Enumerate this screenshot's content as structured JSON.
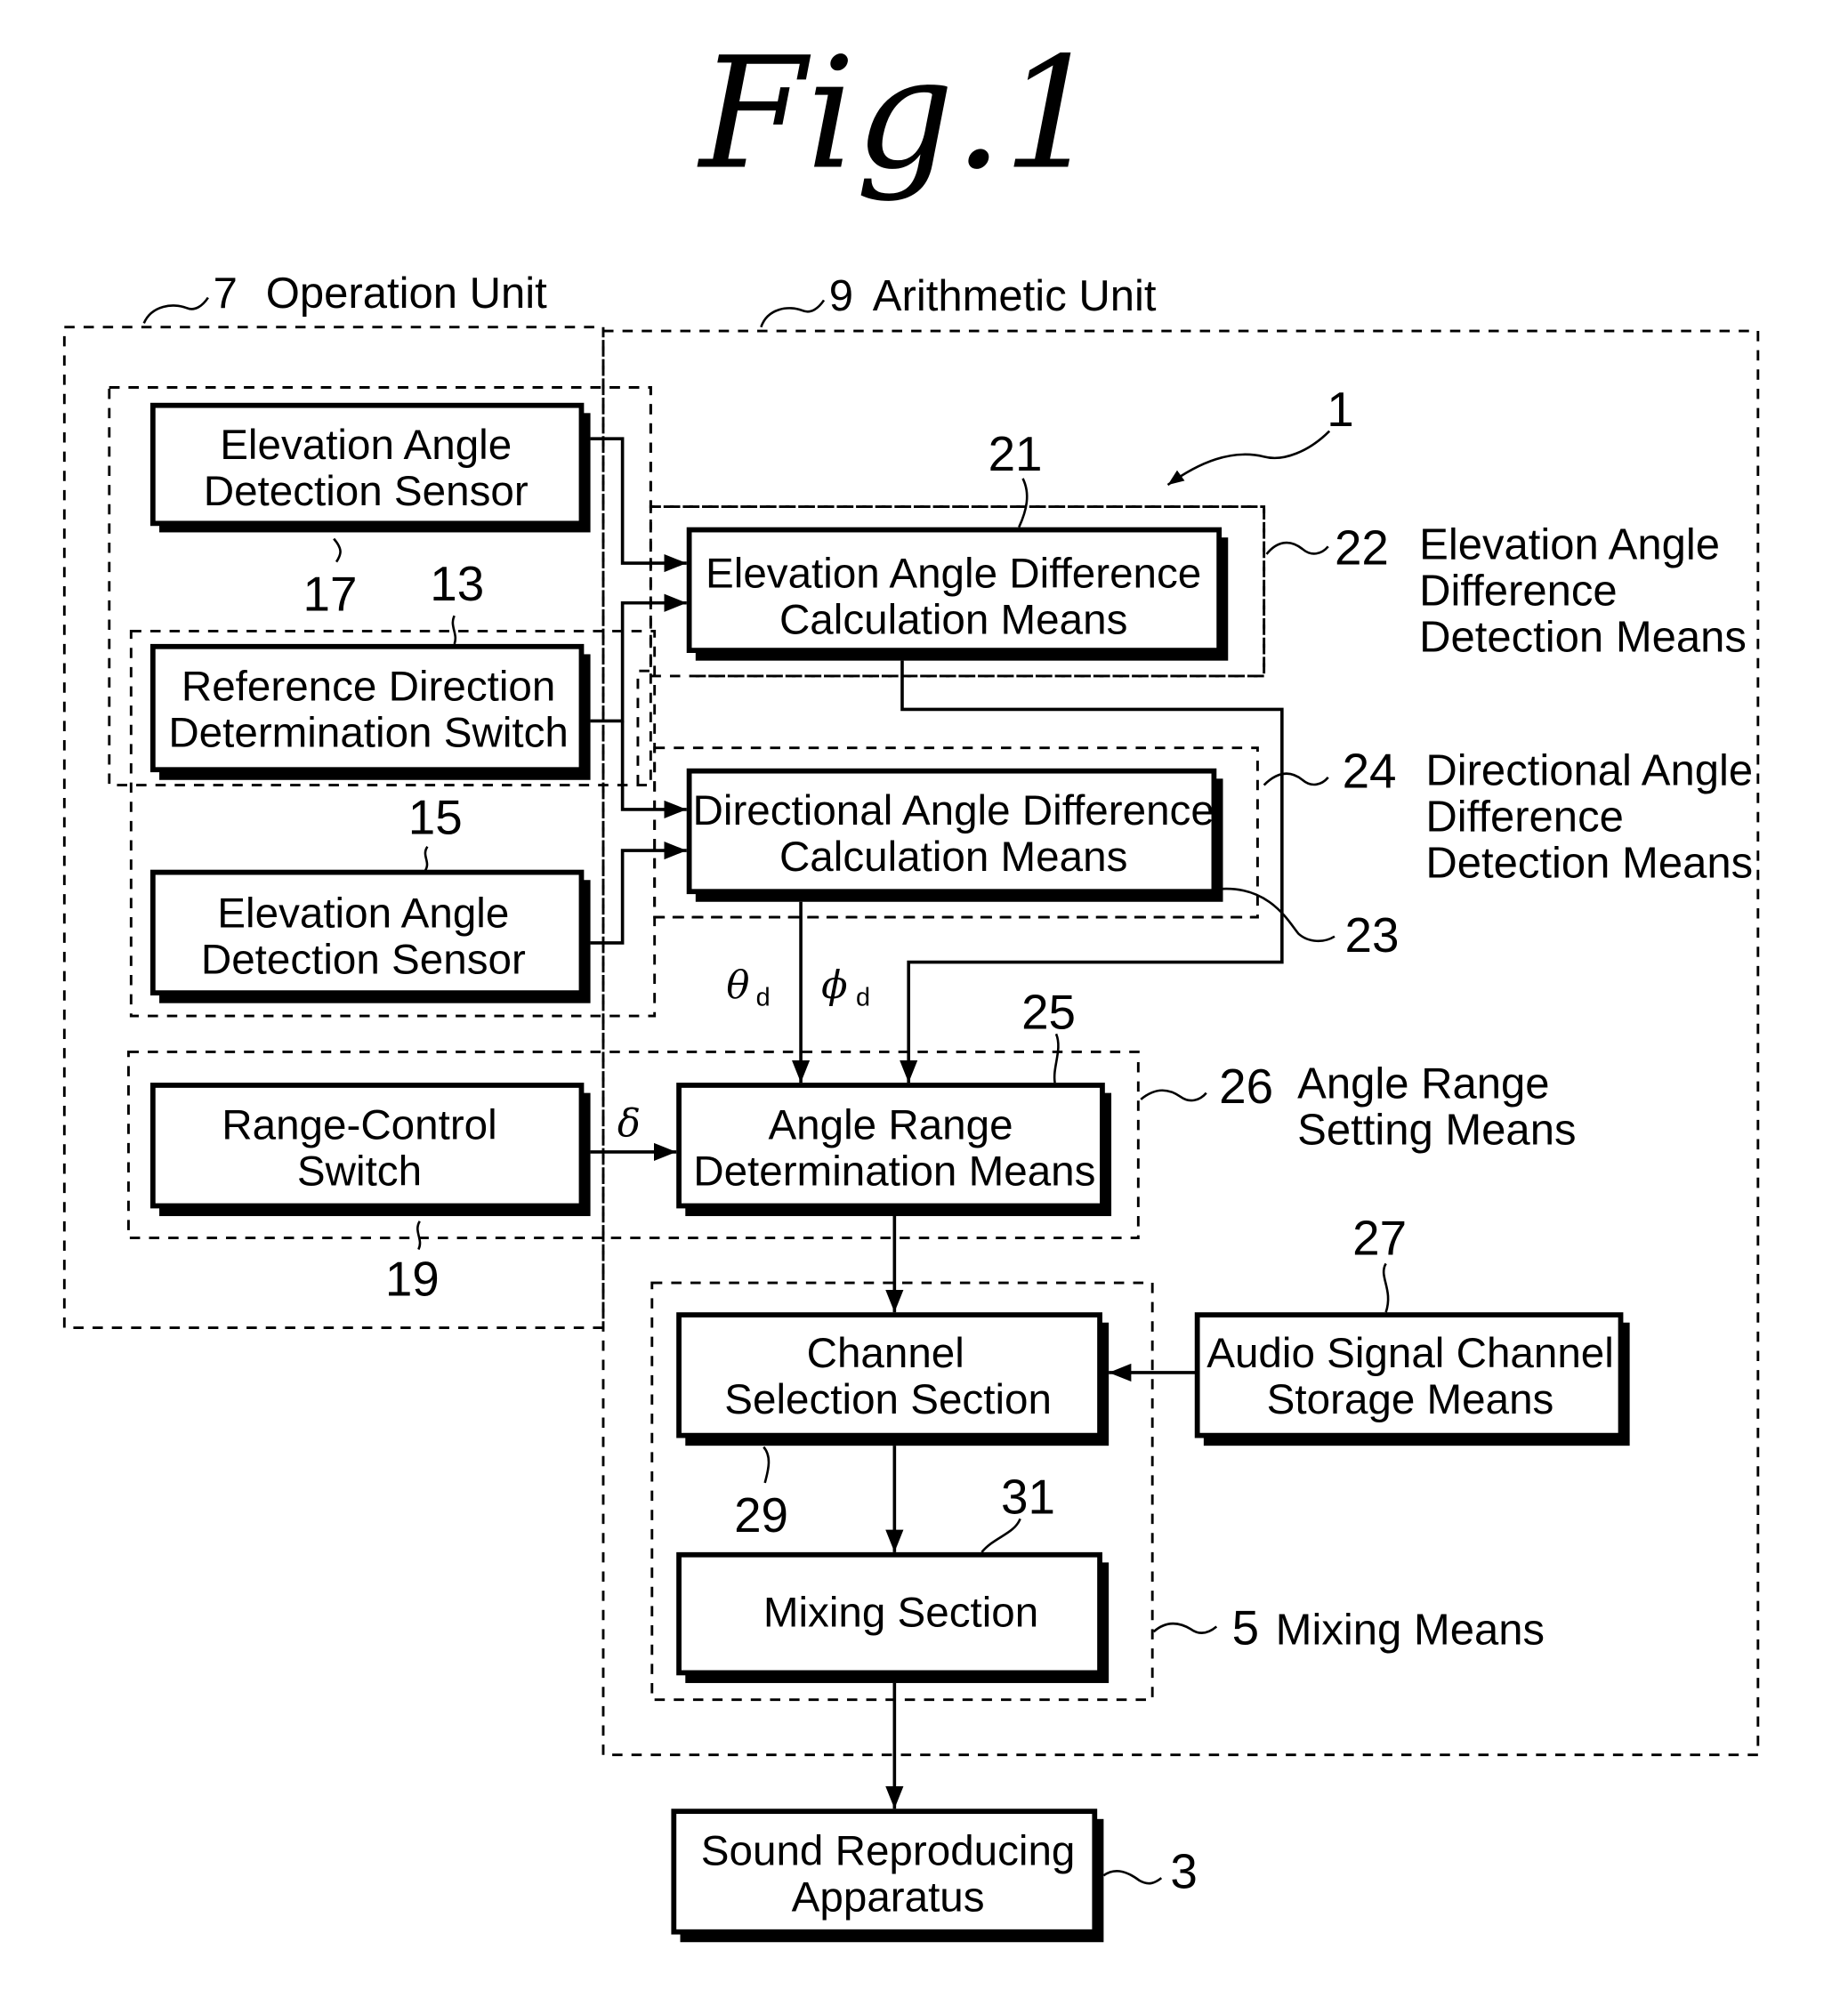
{
  "figure": {
    "title": "Fig.1",
    "ref_system": "1"
  },
  "units": {
    "operation": {
      "ref": "7",
      "label": "Operation Unit"
    },
    "arithmetic": {
      "ref": "9",
      "label": "Arithmetic Unit"
    }
  },
  "boxes": {
    "elev_sensor_top": {
      "ref": "17",
      "lines": [
        "Elevation Angle",
        "Detection Sensor"
      ]
    },
    "ref_dir_switch": {
      "ref": "13",
      "lines": [
        "Reference Direction",
        "Determination Switch"
      ]
    },
    "elev_sensor_bottom": {
      "ref": "15",
      "lines": [
        "Elevation Angle",
        "Detection Sensor"
      ]
    },
    "range_control_switch": {
      "ref": "19",
      "lines": [
        "Range-Control",
        "Switch"
      ]
    },
    "elev_diff_calc": {
      "ref": "21",
      "lines": [
        "Elevation Angle Difference",
        "Calculation Means"
      ]
    },
    "dir_diff_calc": {
      "ref": "23",
      "lines": [
        "Directional Angle Difference",
        "Calculation Means"
      ]
    },
    "angle_range_det": {
      "ref": "25",
      "lines": [
        "Angle Range",
        "Determination Means"
      ]
    },
    "channel_selection": {
      "ref": "29",
      "lines": [
        "Channel",
        "Selection Section"
      ]
    },
    "mixing_section": {
      "ref": "31",
      "lines": [
        "Mixing Section"
      ]
    },
    "audio_storage": {
      "ref": "27",
      "lines": [
        "Audio Signal Channel",
        "Storage Means"
      ]
    },
    "sound_repro": {
      "ref": "3",
      "lines": [
        "Sound Reproducing",
        "Apparatus"
      ]
    }
  },
  "groups": {
    "elev_diff_detection": {
      "ref": "22",
      "lines": [
        "Elevation Angle",
        "Difference",
        "Detection Means"
      ]
    },
    "dir_diff_detection": {
      "ref": "24",
      "lines": [
        "Directional Angle",
        "Difference",
        "Detection Means"
      ]
    },
    "angle_range_setting": {
      "ref": "26",
      "lines": [
        "Angle Range",
        "Setting Means"
      ]
    },
    "mixing_means": {
      "ref": "5",
      "label": "Mixing Means"
    }
  },
  "signals": {
    "theta": "θ",
    "theta_sub": "d",
    "phi": "ϕ",
    "phi_sub": "d",
    "delta": "δ"
  }
}
